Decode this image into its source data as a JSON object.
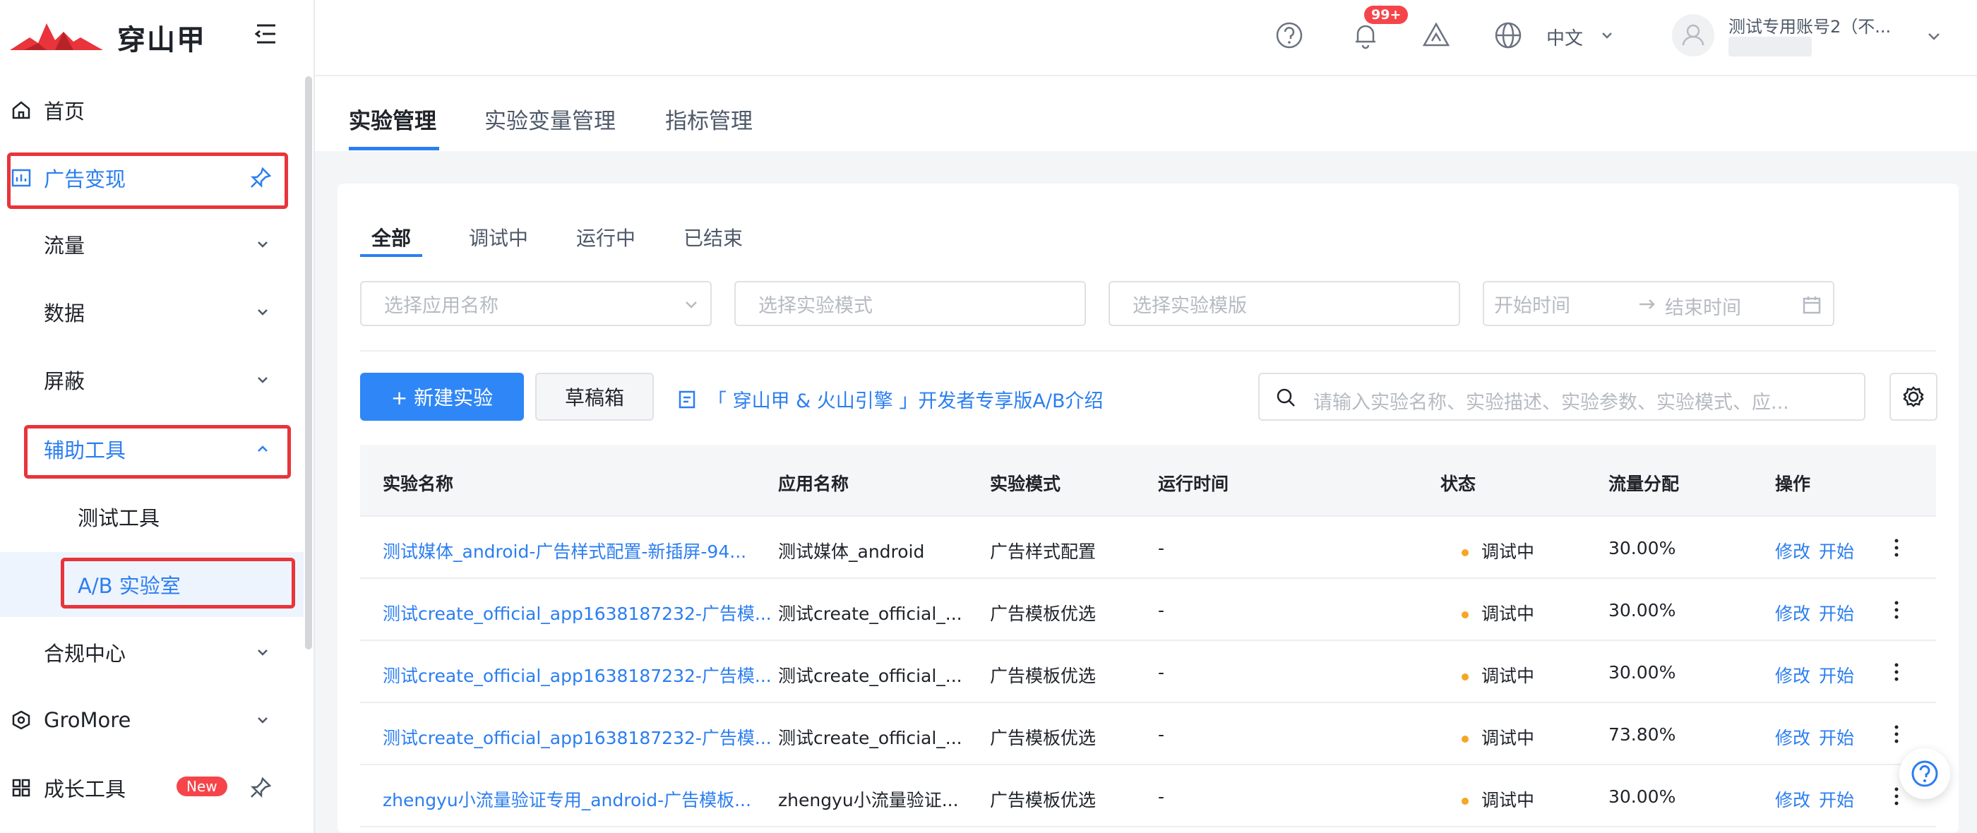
{
  "brand": {
    "name": "穿山甲",
    "logo_color": "#e8343a"
  },
  "sidebar": {
    "items": [
      {
        "label": "首页",
        "icon": "home-icon"
      },
      {
        "label": "广告变现",
        "icon": "chart-icon",
        "pin_icon": "pin-icon"
      },
      {
        "label": "流量"
      },
      {
        "label": "数据"
      },
      {
        "label": "屏蔽"
      },
      {
        "label": "辅助工具"
      },
      {
        "label": "测试工具"
      },
      {
        "label": "A/B 实验室"
      },
      {
        "label": "合规中心"
      },
      {
        "label": "GroMore",
        "icon": "gromore-icon"
      },
      {
        "label": "成长工具",
        "icon": "grid-icon",
        "badge": "New"
      }
    ]
  },
  "header": {
    "notification_count": "99+",
    "language": "中文",
    "account_name": "测试专用账号2（不..."
  },
  "top_tabs": [
    "实验管理",
    "实验变量管理",
    "指标管理"
  ],
  "sub_tabs": [
    "全部",
    "调试中",
    "运行中",
    "已结束"
  ],
  "filters": {
    "app": "选择应用名称",
    "mode": "选择实验模式",
    "template": "选择实验模版",
    "start": "开始时间",
    "end": "结束时间"
  },
  "toolbar": {
    "new_label": "+ 新建实验",
    "draft_label": "草稿箱",
    "intro_link": "「 穿山甲 & 火山引擎 」开发者专享版A/B介绍",
    "search_placeholder": "请输入实验名称、实验描述、实验参数、实验模式、应..."
  },
  "table": {
    "columns": [
      "实验名称",
      "应用名称",
      "实验模式",
      "运行时间",
      "状态",
      "流量分配",
      "操作"
    ],
    "rows": [
      {
        "name": "测试媒体_android-广告样式配置-新插屏-94...",
        "app": "测试媒体_android",
        "mode": "广告样式配置",
        "time": "-",
        "status": "调试中",
        "traffic": "30.00%",
        "edit": "修改",
        "start": "开始"
      },
      {
        "name": "测试create_official_app1638187232-广告模...",
        "app": "测试create_official_...",
        "mode": "广告模板优选",
        "time": "-",
        "status": "调试中",
        "traffic": "30.00%",
        "edit": "修改",
        "start": "开始"
      },
      {
        "name": "测试create_official_app1638187232-广告模...",
        "app": "测试create_official_...",
        "mode": "广告模板优选",
        "time": "-",
        "status": "调试中",
        "traffic": "30.00%",
        "edit": "修改",
        "start": "开始"
      },
      {
        "name": "测试create_official_app1638187232-广告模...",
        "app": "测试create_official_...",
        "mode": "广告模板优选",
        "time": "-",
        "status": "调试中",
        "traffic": "73.80%",
        "edit": "修改",
        "start": "开始"
      },
      {
        "name": "zhengyu小流量验证专用_android-广告模板...",
        "app": "zhengyu小流量验证...",
        "mode": "广告模板优选",
        "time": "-",
        "status": "调试中",
        "traffic": "30.00%",
        "edit": "修改",
        "start": "开始"
      }
    ]
  },
  "colors": {
    "accent": "#2b7ef0",
    "highlight": "#e8343a",
    "status_debug": "#f5a623"
  }
}
